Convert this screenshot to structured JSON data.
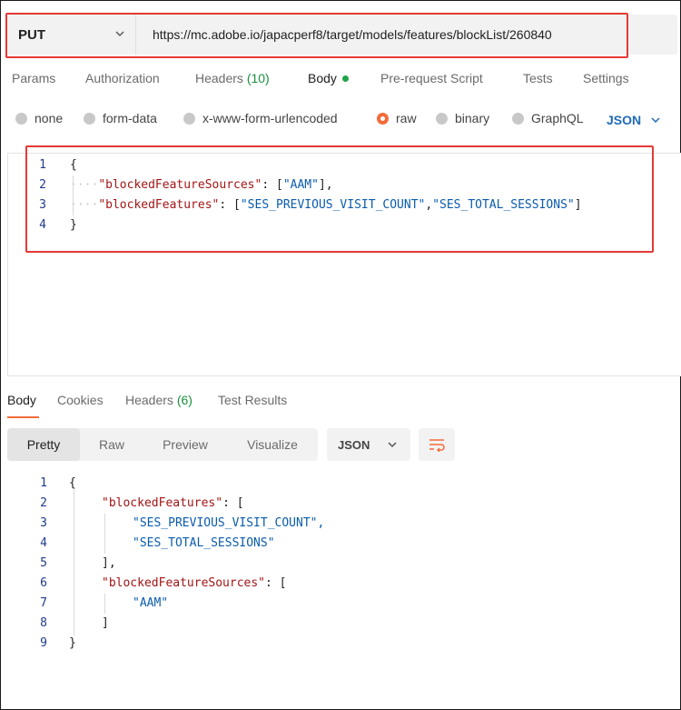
{
  "request": {
    "method": "PUT",
    "url": "https://mc.adobe.io/japacperf8/target/models/features/blockList/260840"
  },
  "request_tabs": [
    {
      "label": "Params"
    },
    {
      "label": "Authorization"
    },
    {
      "label": "Headers",
      "count": "(10)"
    },
    {
      "label": "Body"
    },
    {
      "label": "Pre-request Script"
    },
    {
      "label": "Tests"
    },
    {
      "label": "Settings"
    }
  ],
  "body_types": [
    {
      "label": "none",
      "selected": false
    },
    {
      "label": "form-data",
      "selected": false
    },
    {
      "label": "x-www-form-urlencoded",
      "selected": false
    },
    {
      "label": "raw",
      "selected": true
    },
    {
      "label": "binary",
      "selected": false
    },
    {
      "label": "GraphQL",
      "selected": false
    }
  ],
  "raw_format": "JSON",
  "request_body": {
    "line_numbers": [
      "1",
      "2",
      "3",
      "4"
    ],
    "open_brace": "{",
    "close_brace": "}",
    "key1": "\"blockedFeatureSources\"",
    "colon": ": ",
    "lb": "[",
    "rb": "]",
    "comma": ",",
    "val1": "\"AAM\"",
    "key2": "\"blockedFeatures\"",
    "val2a": "\"SES_PREVIOUS_VISIT_COUNT\"",
    "val2b": "\"SES_TOTAL_SESSIONS\""
  },
  "response_tabs": [
    {
      "label": "Body"
    },
    {
      "label": "Cookies"
    },
    {
      "label": "Headers",
      "count": "(6)"
    },
    {
      "label": "Test Results"
    }
  ],
  "response_views": [
    "Pretty",
    "Raw",
    "Preview",
    "Visualize"
  ],
  "response_format": "JSON",
  "response_body": {
    "line_numbers": [
      "1",
      "2",
      "3",
      "4",
      "5",
      "6",
      "7",
      "8",
      "9"
    ],
    "open_brace": "{",
    "close_brace": "}",
    "key1": "\"blockedFeatures\"",
    "key2": "\"blockedFeatureSources\"",
    "colon": ": ",
    "lb": "[",
    "rb_comma": "],",
    "rb": "]",
    "v1": "\"SES_PREVIOUS_VISIT_COUNT\",",
    "v2": "\"SES_TOTAL_SESSIONS\"",
    "v3": "\"AAM\""
  },
  "colors": {
    "accent": "#f26b3a",
    "highlight_box": "#e53935",
    "key": "#a31515",
    "string": "#0b5cad",
    "count": "#1a8f3c",
    "link": "#1f6ab8"
  },
  "icons": {
    "method_dropdown": "chevron-down-icon",
    "format_dropdown": "chevron-down-icon",
    "wrap": "wrap-lines-icon",
    "body_modified": "dot-icon"
  }
}
